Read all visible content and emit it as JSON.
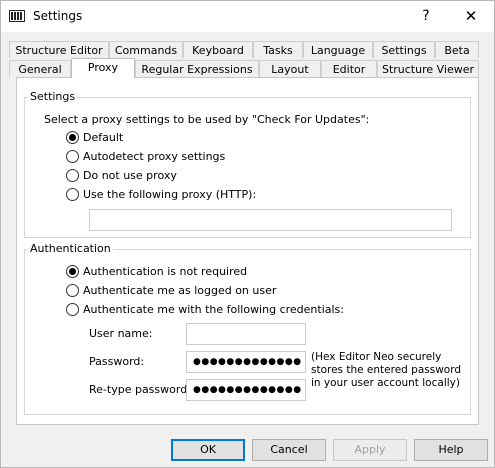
{
  "window": {
    "title": "Settings",
    "help_glyph": "?",
    "close_glyph": "✕"
  },
  "tabs_row1": [
    "Structure Editor",
    "Commands",
    "Keyboard",
    "Tasks",
    "Language",
    "Settings",
    "Beta"
  ],
  "tabs_row2": [
    "General",
    "Proxy",
    "Regular Expressions",
    "Layout",
    "Editor",
    "Structure Viewer"
  ],
  "active_tab": "Proxy",
  "settings_group": {
    "title": "Settings",
    "prompt": "Select a proxy settings to be used by \"Check For Updates\":",
    "options": [
      "Default",
      "Autodetect proxy settings",
      "Do not use proxy",
      "Use the following proxy (HTTP):"
    ],
    "selected": "Default",
    "proxy_value": ""
  },
  "auth_group": {
    "title": "Authentication",
    "options": [
      "Authentication is not required",
      "Authenticate me as logged on user",
      "Authenticate me with the following credentials:"
    ],
    "selected": "Authentication is not required",
    "username_label": "User name:",
    "username_value": "",
    "password_label": "Password:",
    "password_value": "●●●●●●●●●●●●●",
    "retype_label": "Re-type password:",
    "retype_value": "●●●●●●●●●●●●●",
    "note": "(Hex Editor Neo securely stores the entered password in your user account locally)"
  },
  "buttons": {
    "ok": "OK",
    "cancel": "Cancel",
    "apply": "Apply",
    "help": "Help"
  }
}
